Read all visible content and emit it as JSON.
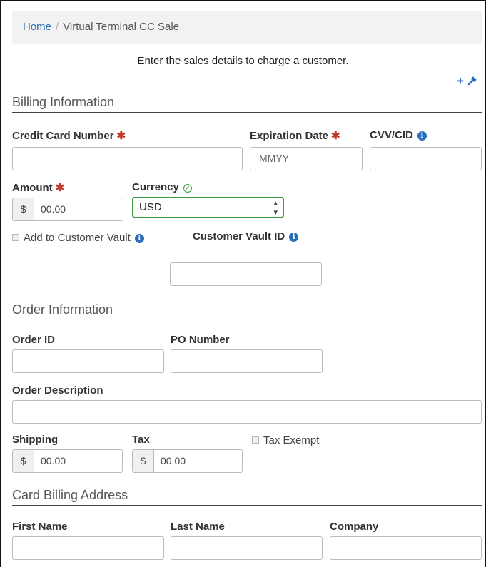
{
  "breadcrumb": {
    "home": "Home",
    "separator": "/",
    "current": "Virtual Terminal CC Sale"
  },
  "intro": "Enter the sales details to charge a customer.",
  "tools": {
    "add": "+",
    "wrench": "wrench-icon"
  },
  "billing": {
    "title": "Billing Information",
    "cc_number_label": "Credit Card Number",
    "expiration_label": "Expiration Date",
    "expiration_placeholder": "MMYY",
    "cvv_label": "CVV/CID",
    "amount_label": "Amount",
    "amount_prefix": "$",
    "amount_value": "00.00",
    "currency_label": "Currency",
    "currency_value": "USD",
    "vault_check_label": "Add to Customer Vault",
    "vault_id_label": "Customer Vault ID",
    "required_mark": "✱"
  },
  "order": {
    "title": "Order Information",
    "order_id_label": "Order ID",
    "po_number_label": "PO Number",
    "description_label": "Order Description",
    "shipping_label": "Shipping",
    "shipping_prefix": "$",
    "shipping_value": "00.00",
    "tax_label": "Tax",
    "tax_prefix": "$",
    "tax_value": "00.00",
    "tax_exempt_label": "Tax Exempt"
  },
  "address": {
    "title": "Card Billing Address",
    "first_name_label": "First Name",
    "last_name_label": "Last Name",
    "company_label": "Company"
  },
  "colors": {
    "link": "#2a6ebb",
    "required": "#c0392b",
    "valid": "#3c9a3c"
  }
}
